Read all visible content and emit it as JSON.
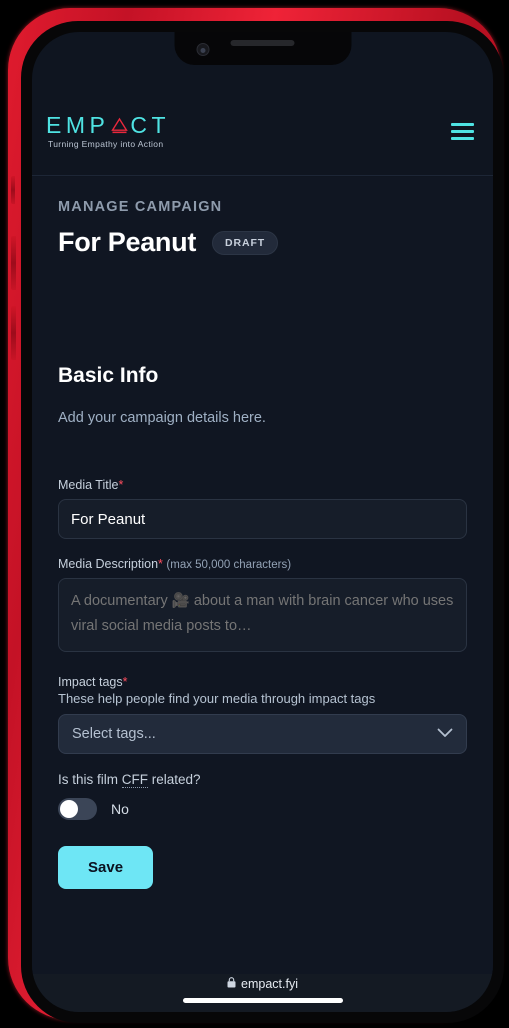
{
  "brand": {
    "logo_text_part1": "EMP",
    "logo_icon": "red-triangle-icon",
    "logo_text_part2": "CT",
    "tagline": "Turning Empathy into Action",
    "accent_cyan": "#4FE3E3",
    "accent_red": "#E01B2E",
    "button_cyan": "#6EE6F5"
  },
  "header": {
    "menu_icon": "hamburger-menu-icon"
  },
  "page": {
    "eyebrow": "MANAGE CAMPAIGN",
    "title": "For Peanut",
    "status_badge": "DRAFT"
  },
  "section": {
    "heading": "Basic Info",
    "subheading": "Add your campaign details here."
  },
  "fields": {
    "media_title": {
      "label": "Media Title",
      "required_marker": "*",
      "value": "For Peanut"
    },
    "media_description": {
      "label": "Media Description",
      "required_marker": "*",
      "hint": "(max 50,000 characters)",
      "placeholder": "A documentary 🎥 about a man with brain cancer who uses viral social media posts to…"
    },
    "impact_tags": {
      "label": "Impact tags",
      "required_marker": "*",
      "helper": "These help people find your media through impact tags",
      "placeholder": "Select tags...",
      "chevron_icon": "chevron-down-icon"
    },
    "cff_related": {
      "question_prefix": "Is this film ",
      "abbr": "CFF",
      "question_suffix": " related?",
      "toggle_state_label": "No"
    }
  },
  "actions": {
    "save_label": "Save"
  },
  "browser": {
    "lock_icon": "lock-icon",
    "url": "empact.fyi"
  }
}
